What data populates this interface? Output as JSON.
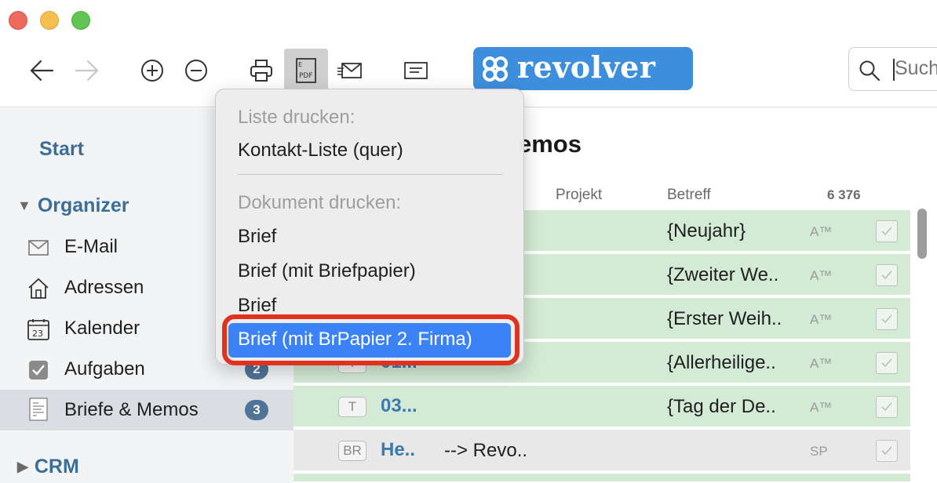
{
  "window": {
    "traffic_lights": [
      "close",
      "minimize",
      "zoom"
    ]
  },
  "toolbar": {
    "buttons": [
      {
        "name": "back",
        "icon": "arrow-left-icon"
      },
      {
        "name": "forward",
        "icon": "arrow-right-icon"
      },
      {
        "name": "zoom-in",
        "icon": "plus-circle-icon"
      },
      {
        "name": "zoom-out",
        "icon": "minus-circle-icon"
      },
      {
        "name": "print",
        "icon": "printer-icon"
      },
      {
        "name": "pdf",
        "icon": "pdf-icon",
        "label": "PDF"
      },
      {
        "name": "mail",
        "icon": "envelope-icon"
      },
      {
        "name": "memo",
        "icon": "memo-icon"
      }
    ],
    "logo_text": "revolver",
    "search_placeholder": "Suche"
  },
  "sidebar": {
    "start_label": "Start",
    "organizer_label": "Organizer",
    "items": [
      {
        "label": "E-Mail",
        "icon": "envelope-icon",
        "badge": ""
      },
      {
        "label": "Adressen",
        "icon": "house-icon",
        "badge": ""
      },
      {
        "label": "Kalender",
        "icon": "calendar-icon",
        "icon_text": "23",
        "badge": ""
      },
      {
        "label": "Aufgaben",
        "icon": "checkbox-icon",
        "badge": "2"
      },
      {
        "label": "Briefe & Memos",
        "icon": "letter-icon",
        "badge": "3"
      }
    ],
    "crm_label": "CRM"
  },
  "content": {
    "title": "Briefe & Memos",
    "title_visible": "emos",
    "columns": {
      "projekt": "Projekt",
      "betreff": "Betreff"
    },
    "count": "6 376",
    "rows": [
      {
        "tag": "",
        "date": "",
        "projekt": "",
        "betreff": "{Neujahr}",
        "initials": "A™",
        "checked": true,
        "color": "green"
      },
      {
        "tag": "",
        "date": "",
        "projekt": "",
        "betreff": "{Zweiter We..",
        "initials": "A™",
        "checked": true,
        "color": "green"
      },
      {
        "tag": "",
        "date": "",
        "projekt": "",
        "betreff": "{Erster Weih..",
        "initials": "A™",
        "checked": true,
        "color": "green"
      },
      {
        "tag": "T",
        "date": "01...",
        "projekt": "",
        "betreff": "{Allerheilige..",
        "initials": "A™",
        "checked": true,
        "color": "green"
      },
      {
        "tag": "T",
        "date": "03...",
        "projekt": "",
        "betreff": "{Tag der De..",
        "initials": "A™",
        "checked": true,
        "color": "green"
      },
      {
        "tag": "BR",
        "date": "He..",
        "projekt": "--> Revo..",
        "betreff": "",
        "initials": "SP",
        "checked": true,
        "color": "grey"
      }
    ]
  },
  "print_menu": {
    "list_header": "Liste drucken:",
    "list_items": [
      "Kontakt-Liste (quer)"
    ],
    "doc_header": "Dokument drucken:",
    "doc_items": [
      "Brief",
      "Brief (mit Briefpapier)",
      "Brief"
    ],
    "highlighted_item": "Brief (mit BrPapier 2. Firma)"
  },
  "colors": {
    "accent": "#3b82f6",
    "logo_bg": "#3d8fdd",
    "sidebar_bg": "#f2f4f6",
    "row_green": "#d3ead5",
    "badge_bg": "#4f7498",
    "annotation": "#e0321f"
  }
}
